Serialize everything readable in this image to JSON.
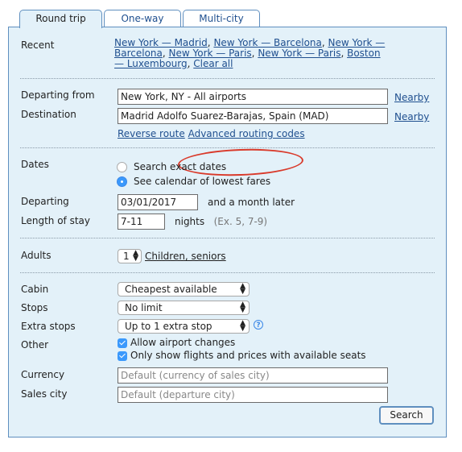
{
  "tabs": [
    {
      "label": "Round trip",
      "active": true
    },
    {
      "label": "One-way",
      "active": false
    },
    {
      "label": "Multi-city",
      "active": false
    }
  ],
  "recent": {
    "label": "Recent",
    "links": [
      "New York — Madrid",
      "New York — Barcelona",
      "New York — Barcelona",
      "New York — Paris",
      "New York — Paris",
      "Boston — Luxembourg",
      "Clear all"
    ]
  },
  "route": {
    "departing_label": "Departing from",
    "departing_value": "New York, NY - All airports",
    "destination_label": "Destination",
    "destination_value": "Madrid Adolfo Suarez-Barajas, Spain (MAD)",
    "nearby_label": "Nearby",
    "reverse_route": "Reverse route",
    "advanced_routing": "Advanced routing codes",
    "annotation_color": "#d93a2b"
  },
  "dates": {
    "label": "Dates",
    "options": [
      {
        "label": "Search exact dates",
        "selected": false
      },
      {
        "label": "See calendar of lowest fares",
        "selected": true
      }
    ],
    "departing_label": "Departing",
    "departing_value": "03/01/2017",
    "departing_suffix": "and a month later",
    "stay_label": "Length of stay",
    "stay_value": "7-11",
    "stay_suffix": "nights",
    "stay_hint": "(Ex. 5, 7-9)"
  },
  "passengers": {
    "adults_label": "Adults",
    "adults_value": "1",
    "children_link": "Children, seniors"
  },
  "options": {
    "cabin_label": "Cabin",
    "cabin_value": "Cheapest available",
    "stops_label": "Stops",
    "stops_value": "No limit",
    "extra_stops_label": "Extra stops",
    "extra_stops_value": "Up to 1 extra stop",
    "help_icon": "?",
    "other_label": "Other",
    "other_checks": [
      {
        "label": "Allow airport changes",
        "checked": true
      },
      {
        "label": "Only show flights and prices with available seats",
        "checked": true
      }
    ],
    "currency_label": "Currency",
    "currency_placeholder": "Default (currency of sales city)",
    "sales_city_label": "Sales city",
    "sales_city_placeholder": "Default (departure city)"
  },
  "search_button": "Search",
  "colors": {
    "panel_bg": "#e3f1f9",
    "border": "#5f8fbf",
    "link": "#1f4f8f",
    "accent": "#3b99fc"
  }
}
